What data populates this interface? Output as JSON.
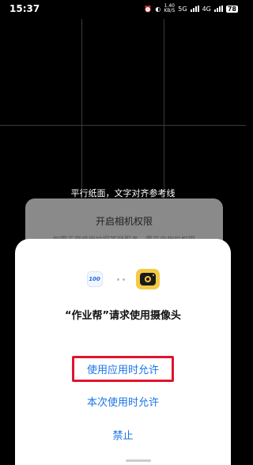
{
  "status_bar": {
    "time": "15:37",
    "net_speed_value": "1.40",
    "net_speed_unit": "KB/S",
    "network_1": "5G",
    "network_2": "4G",
    "battery": "78"
  },
  "camera": {
    "hint": "平行纸面，文字对齐参考线"
  },
  "permission_card": {
    "title": "开启相机权限",
    "description": "如需正常使用拍摄答疑服务，需开启相机权限"
  },
  "dialog": {
    "app_icon_text": "100",
    "title": "“作业帮”请求使用摄像头",
    "allow_while_using_label": "使用应用时允许",
    "allow_once_label": "本次使用时允许",
    "deny_label": "禁止",
    "highlight_color": "#e0142e",
    "accent_color": "#1a74e8"
  }
}
